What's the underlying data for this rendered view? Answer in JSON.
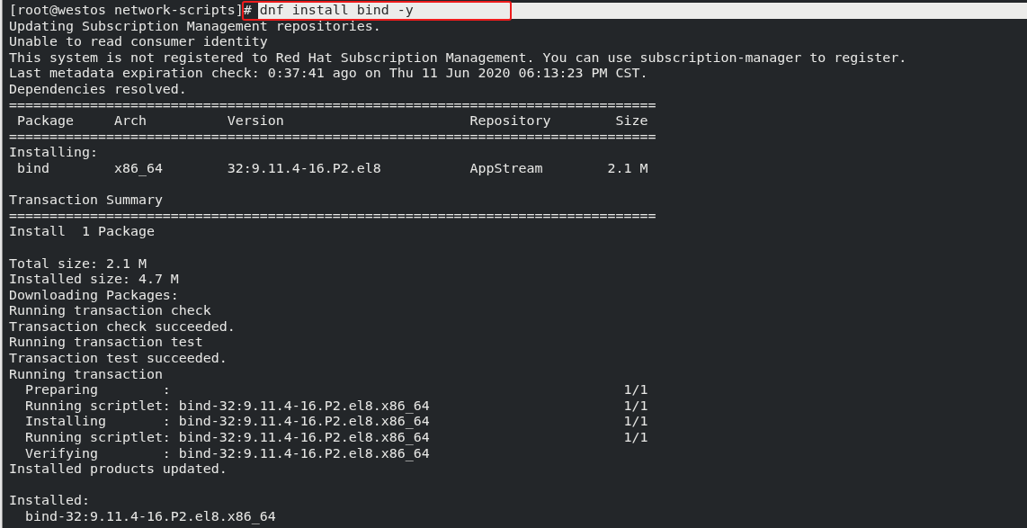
{
  "terminal": {
    "prompt_line": {
      "prompt": "[root@westos network-scripts]#",
      "command": "dnf install bind -y",
      "selected": true,
      "annotated": true
    },
    "output_blocks": [
      [
        "Updating Subscription Management repositories.",
        "Unable to read consumer identity",
        "This system is not registered to Red Hat Subscription Management. You can use subscription-manager to register.",
        "Last metadata expiration check: 0:37:41 ago on Thu 11 Jun 2020 06:13:23 PM CST.",
        "Dependencies resolved.",
        "================================================================================",
        " Package     Arch          Version                       Repository        Size",
        "================================================================================",
        "Installing:",
        " bind        x86_64        32:9.11.4-16.P2.el8           AppStream        2.1 M"
      ],
      [
        "Transaction Summary",
        "================================================================================",
        "Install  1 Package"
      ],
      [
        "Total size: 2.1 M",
        "Installed size: 4.7 M",
        "Downloading Packages:",
        "Running transaction check",
        "Transaction check succeeded.",
        "Running transaction test",
        "Transaction test succeeded.",
        "Running transaction",
        "  Preparing        :                                                        1/1",
        "  Running scriptlet: bind-32:9.11.4-16.P2.el8.x86_64                        1/1",
        "  Installing       : bind-32:9.11.4-16.P2.el8.x86_64                        1/1",
        "  Running scriptlet: bind-32:9.11.4-16.P2.el8.x86_64                        1/1",
        "  Verifying        : bind-32:9.11.4-16.P2.el8.x86_64",
        "Installed products updated."
      ],
      [
        "Installed:",
        "  bind-32:9.11.4-16.P2.el8.x86_64"
      ]
    ]
  }
}
